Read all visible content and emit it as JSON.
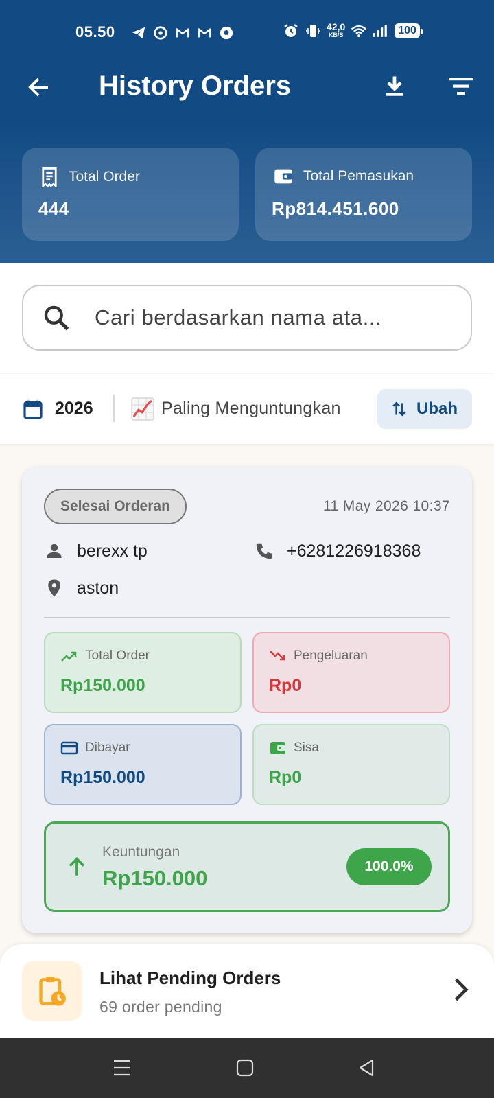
{
  "status_bar": {
    "time": "05.50",
    "net_speed_value": "42,0",
    "net_speed_unit": "KB/S",
    "battery": "100"
  },
  "app_bar": {
    "title": "History Orders"
  },
  "summary": {
    "total_order_label": "Total Order",
    "total_order_value": "444",
    "total_income_label": "Total Pemasukan",
    "total_income_value": "Rp814.451.600"
  },
  "search": {
    "placeholder": "Cari berdasarkan nama ata..."
  },
  "filter": {
    "year": "2026",
    "sort_emoji": "📈",
    "sort_label": "Paling Menguntungkan",
    "change_button": "Ubah"
  },
  "order": {
    "status": "Selesai Orderan",
    "date": "11 May 2026 10:37",
    "customer_name": "berexx tp",
    "phone": "+6281226918368",
    "address": "aston",
    "total_order_label": "Total Order",
    "total_order_value": "Rp150.000",
    "expense_label": "Pengeluaran",
    "expense_value": "Rp0",
    "paid_label": "Dibayar",
    "paid_value": "Rp150.000",
    "remaining_label": "Sisa",
    "remaining_value": "Rp0",
    "profit_label": "Keuntungan",
    "profit_value": "Rp150.000",
    "profit_percent": "100.0%"
  },
  "pending": {
    "title": "Lihat Pending Orders",
    "subtitle": "69 order pending"
  },
  "colors": {
    "primary": "#124b84",
    "success": "#3ea54b",
    "danger": "#d8383b",
    "pending_icon": "#f5a623"
  }
}
